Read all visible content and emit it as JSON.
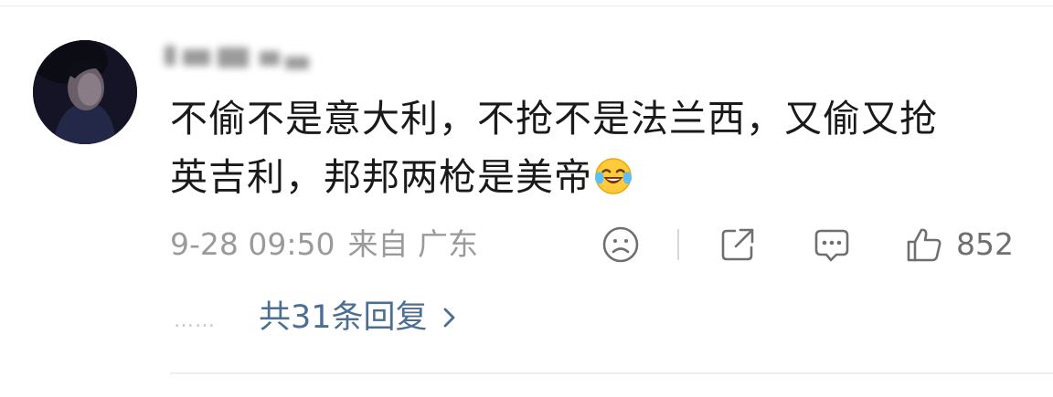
{
  "comment": {
    "text_line1": "不偷不是意大利，不抢不是法兰西，又偷又抢",
    "text_line2": "英吉利，邦邦两枪是美帝",
    "emoji": "laugh-cry-emoji",
    "timestamp": "9-28 09:50",
    "source": "来自 广东",
    "like_count": "852"
  },
  "actions": {
    "dislike_icon": "sad-face-icon",
    "share_icon": "share-icon",
    "comment_icon": "comment-bubble-icon",
    "like_icon": "thumbs-up-icon"
  },
  "replies": {
    "dots": "……",
    "label": "共31条回复"
  },
  "colors": {
    "text": "#1a1a1a",
    "meta": "#9a9a9a",
    "link": "#4b6e93",
    "divider": "#eeeeee"
  }
}
